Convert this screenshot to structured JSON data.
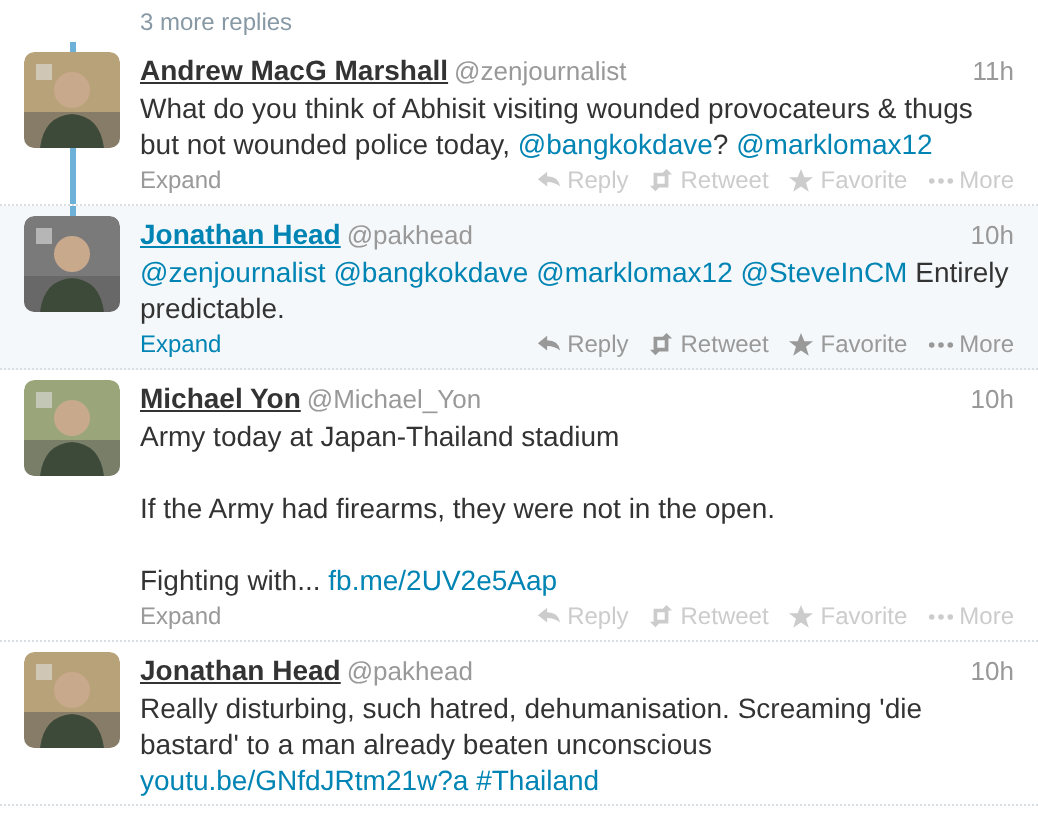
{
  "more_replies": "3 more replies",
  "tweets": [
    {
      "name": "Andrew MacG Marshall",
      "handle": "@zenjournalist",
      "time": "11h",
      "hovered": false,
      "line_above": true,
      "line_below": true,
      "text": [
        {
          "kind": "text",
          "text": "What do you think of Abhisit visiting wounded provocateurs & thugs but not wounded police today, "
        },
        {
          "kind": "link",
          "text": "@bangkokdave"
        },
        {
          "kind": "text",
          "text": "? "
        },
        {
          "kind": "link",
          "text": "@marklomax12"
        }
      ],
      "expand": "Expand",
      "actions": [
        "Reply",
        "Retweet",
        "Favorite",
        "More"
      ]
    },
    {
      "name": "Jonathan Head",
      "handle": "@pakhead",
      "time": "10h",
      "hovered": true,
      "line_above": true,
      "line_below": false,
      "text": [
        {
          "kind": "link",
          "text": "@zenjournalist"
        },
        {
          "kind": "space"
        },
        {
          "kind": "link",
          "text": "@bangkokdave"
        },
        {
          "kind": "space"
        },
        {
          "kind": "link",
          "text": "@marklomax12"
        },
        {
          "kind": "space"
        },
        {
          "kind": "link",
          "text": "@SteveInCM"
        },
        {
          "kind": "text",
          "text": " Entirely predictable."
        }
      ],
      "expand": "Expand",
      "actions": [
        "Reply",
        "Retweet",
        "Favorite",
        "More"
      ]
    },
    {
      "name": "Michael Yon",
      "handle": "@Michael_Yon",
      "time": "10h",
      "hovered": false,
      "line_above": false,
      "line_below": false,
      "text": [
        {
          "kind": "text",
          "text": "Army today at Japan-Thailand stadium"
        },
        {
          "kind": "break"
        },
        {
          "kind": "break"
        },
        {
          "kind": "text",
          "text": "If the Army had firearms, they were not in the open."
        },
        {
          "kind": "break"
        },
        {
          "kind": "break"
        },
        {
          "kind": "text",
          "text": "Fighting with... "
        },
        {
          "kind": "link",
          "text": "fb.me/2UV2e5Aap"
        }
      ],
      "expand": "Expand",
      "actions": [
        "Reply",
        "Retweet",
        "Favorite",
        "More"
      ]
    },
    {
      "name": "Jonathan Head",
      "handle": "@pakhead",
      "time": "10h",
      "hovered": false,
      "line_above": false,
      "line_below": false,
      "text": [
        {
          "kind": "text",
          "text": "Really disturbing, such hatred, dehumanisation. Screaming 'die bastard' to a man already beaten unconscious "
        },
        {
          "kind": "link",
          "text": "youtu.be/GNfdJRtm21w?a"
        },
        {
          "kind": "space"
        },
        {
          "kind": "link",
          "text": "#Thailand"
        }
      ]
    }
  ]
}
